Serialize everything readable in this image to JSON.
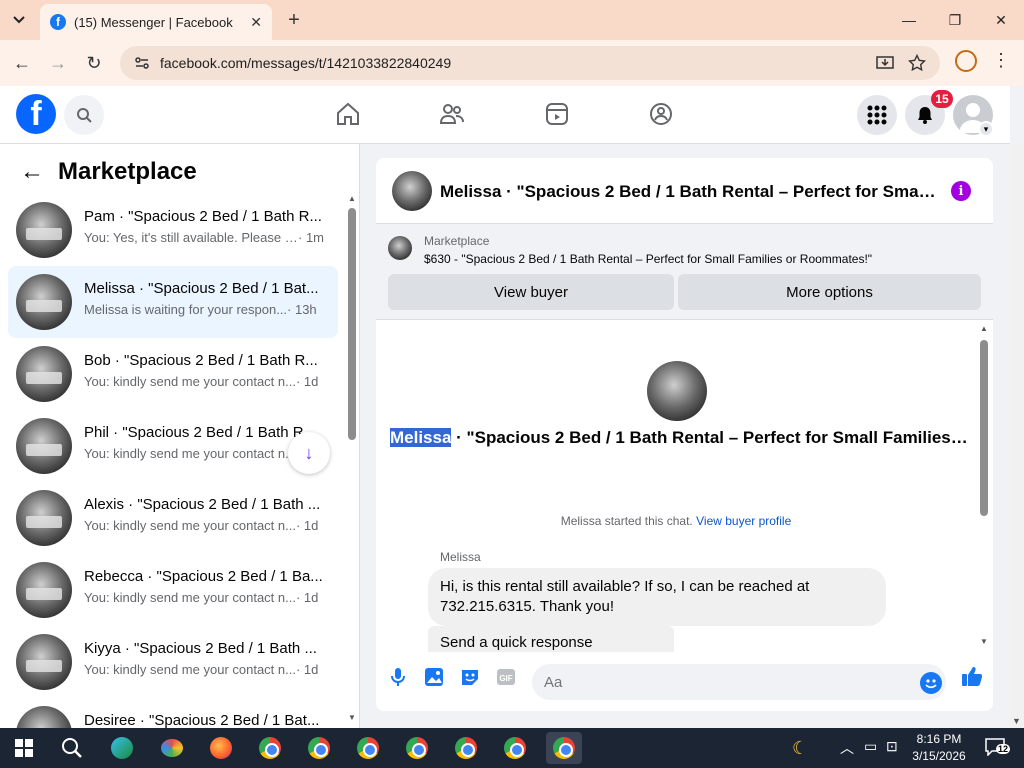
{
  "browser": {
    "tab_title": "(15) Messenger | Facebook",
    "url": "facebook.com/messages/t/1421033822840249",
    "tab_close_icon": "close-icon",
    "new_tab_label": "+"
  },
  "fb": {
    "logo_letter": "f",
    "notification_count": "15"
  },
  "marketplace": {
    "heading": "Marketplace",
    "conversations": [
      {
        "name": "Pam · \"Spacious 2 Bed / 1 Bath R...",
        "snippet": "You: Yes, it's still available. Please s...",
        "time": " · 1m",
        "active": false
      },
      {
        "name": "Melissa · \"Spacious 2 Bed / 1 Bat...",
        "snippet": "Melissa is waiting for your respon...",
        "time": " · 13h",
        "active": true
      },
      {
        "name": "Bob · \"Spacious 2 Bed / 1 Bath R...",
        "snippet": "You: kindly send me your contact n...",
        "time": " · 1d",
        "active": false
      },
      {
        "name": "Phil · \"Spacious 2 Bed / 1 Bath R...",
        "snippet": "You: kindly send me your contact n...",
        "time": " · 1d",
        "active": false
      },
      {
        "name": "Alexis · \"Spacious 2 Bed / 1 Bath ...",
        "snippet": "You: kindly send me your contact n...",
        "time": " · 1d",
        "active": false
      },
      {
        "name": "Rebecca · \"Spacious 2 Bed / 1 Ba...",
        "snippet": "You: kindly send me your contact n...",
        "time": " · 1d",
        "active": false
      },
      {
        "name": "Kiyya · \"Spacious 2 Bed / 1 Bath ...",
        "snippet": "You: kindly send me your contact n...",
        "time": " · 1d",
        "active": false
      },
      {
        "name": "Desiree · \"Spacious 2 Bed / 1 Bat...",
        "snippet": "",
        "time": "",
        "active": false
      }
    ]
  },
  "chat": {
    "header_title": "Melissa · \"Spacious 2 Bed / 1 Bath Rental – Perfect for Small Fa...",
    "info_label": "i",
    "banner_label": "Marketplace",
    "banner_desc": "$630 - \"Spacious 2 Bed / 1 Bath Rental – Perfect for Small Families or Roommates!\"",
    "view_buyer": "View buyer",
    "more_options": "More options",
    "title_highlight": "Melissa",
    "title_rest": " · \"Spacious 2 Bed / 1 Bath Rental – Perfect for Small Families or R...",
    "started_text": "Melissa started this chat.",
    "view_buyer_profile": "View buyer profile",
    "sender": "Melissa",
    "message": "Hi, is this rental still available? If so, I can be reached at 732.215.6315. Thank you!",
    "quick_response": "Send a quick response",
    "composer_placeholder": "Aa"
  },
  "taskbar": {
    "time": "8:16 PM",
    "date": "3/15/2026",
    "notifications": "12"
  }
}
